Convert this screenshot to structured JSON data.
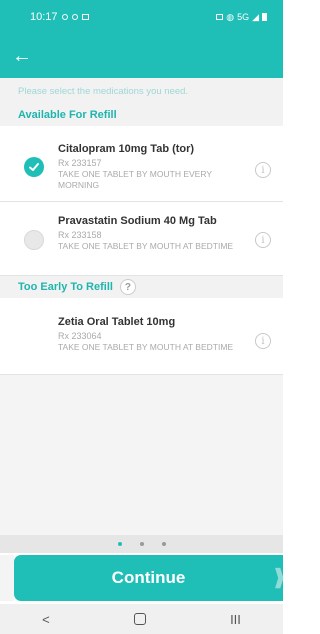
{
  "status_bar": {
    "time": "10:17",
    "network": "5G"
  },
  "app_bar": {
    "back_icon": "arrow-left-icon"
  },
  "instruction": "Please select the medications you need.",
  "sections": {
    "available": {
      "title": "Available For Refill",
      "items": [
        {
          "name": "Citalopram 10mg Tab (tor)",
          "rx": "Rx 233157",
          "sig": "TAKE ONE TABLET BY MOUTH EVERY MORNING",
          "selected": true
        },
        {
          "name": "Pravastatin Sodium 40 Mg Tab",
          "rx": "Rx 233158",
          "sig": "TAKE ONE TABLET BY MOUTH AT BEDTIME",
          "selected": false
        }
      ]
    },
    "too_early": {
      "title": "Too Early To Refill",
      "help": "?",
      "items": [
        {
          "name": "Zetia Oral Tablet 10mg",
          "rx": "Rx 233064",
          "sig": "TAKE ONE TABLET BY MOUTH AT BEDTIME"
        }
      ]
    }
  },
  "pager": {
    "pages": 3,
    "active_index": 0
  },
  "continue_label": "Continue",
  "colors": {
    "accent": "#1fbfb8",
    "section_title": "#1fb5ae"
  },
  "nav": {
    "back": "<",
    "recents": "III"
  }
}
